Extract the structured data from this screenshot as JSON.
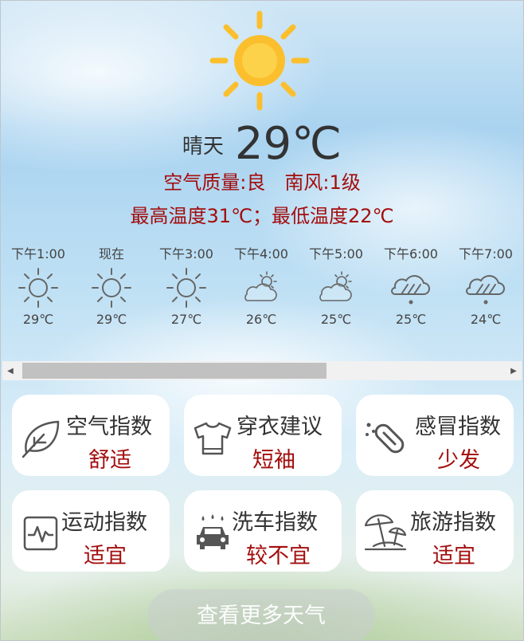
{
  "current": {
    "condition": "晴天",
    "temperature": "29℃",
    "air_quality": "空气质量:良",
    "wind": "南风:1级",
    "range": "最高温度31℃；最低温度22℃"
  },
  "hourly": [
    {
      "time": "下午1:00",
      "icon": "sun-icon",
      "temp": "29℃"
    },
    {
      "time": "现在",
      "icon": "sun-icon",
      "temp": "29℃"
    },
    {
      "time": "下午3:00",
      "icon": "sun-icon",
      "temp": "27℃"
    },
    {
      "time": "下午4:00",
      "icon": "partly-cloudy-icon",
      "temp": "26℃"
    },
    {
      "time": "下午5:00",
      "icon": "partly-cloudy-icon",
      "temp": "25℃"
    },
    {
      "time": "下午6:00",
      "icon": "rain-cloud-icon",
      "temp": "25℃"
    },
    {
      "time": "下午7:00",
      "icon": "rain-cloud-icon",
      "temp": "24℃"
    }
  ],
  "indices": [
    {
      "title": "空气指数",
      "value": "舒适",
      "icon": "leaf-icon"
    },
    {
      "title": "穿衣建议",
      "value": "短袖",
      "icon": "tshirt-icon"
    },
    {
      "title": "感冒指数",
      "value": "少发",
      "icon": "pill-icon"
    },
    {
      "title": "运动指数",
      "value": "适宜",
      "icon": "heartbeat-monitor-icon"
    },
    {
      "title": "洗车指数",
      "value": "较不宜",
      "icon": "car-wash-icon"
    },
    {
      "title": "旅游指数",
      "value": "适宜",
      "icon": "beach-umbrella-icon"
    }
  ],
  "more_button": "查看更多天气",
  "colors": {
    "accent_red": "#a30d0d",
    "sun_yellow": "#fbbf2e",
    "text": "#333333"
  }
}
